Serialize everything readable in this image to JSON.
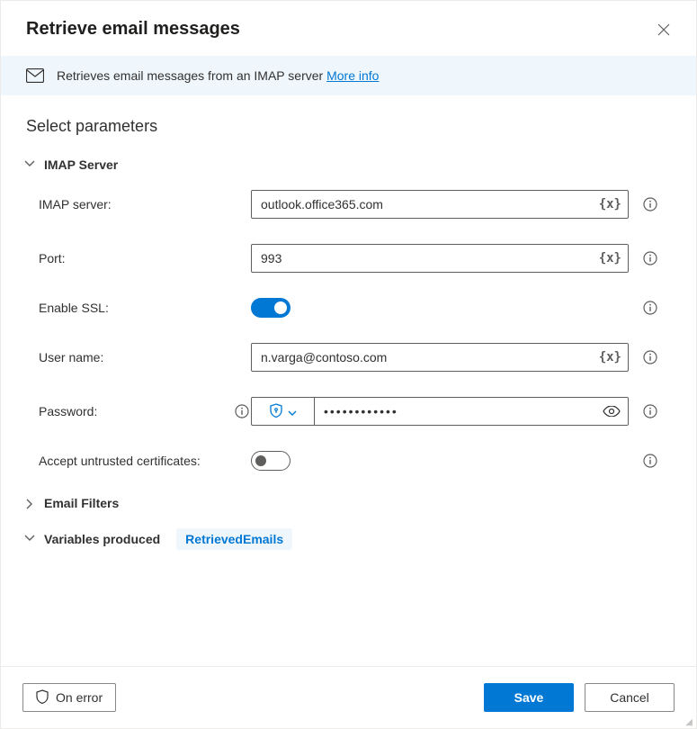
{
  "header": {
    "title": "Retrieve email messages"
  },
  "banner": {
    "text": "Retrieves email messages from an IMAP server ",
    "more_info": "More info"
  },
  "section_title": "Select parameters",
  "sections": {
    "imap": {
      "heading": "IMAP Server",
      "fields": {
        "server": {
          "label": "IMAP server:",
          "value": "outlook.office365.com"
        },
        "port": {
          "label": "Port:",
          "value": "993"
        },
        "ssl": {
          "label": "Enable SSL:",
          "on": true
        },
        "user": {
          "label": "User name:",
          "value": "n.varga@contoso.com"
        },
        "password": {
          "label": "Password:",
          "value": "••••••••••••"
        },
        "accept_untrusted": {
          "label": "Accept untrusted certificates:",
          "on": false
        }
      }
    },
    "filters": {
      "heading": "Email Filters"
    },
    "variables": {
      "heading": "Variables produced",
      "chip": "RetrievedEmails"
    }
  },
  "footer": {
    "on_error": "On error",
    "save": "Save",
    "cancel": "Cancel"
  },
  "var_token": "{x}"
}
